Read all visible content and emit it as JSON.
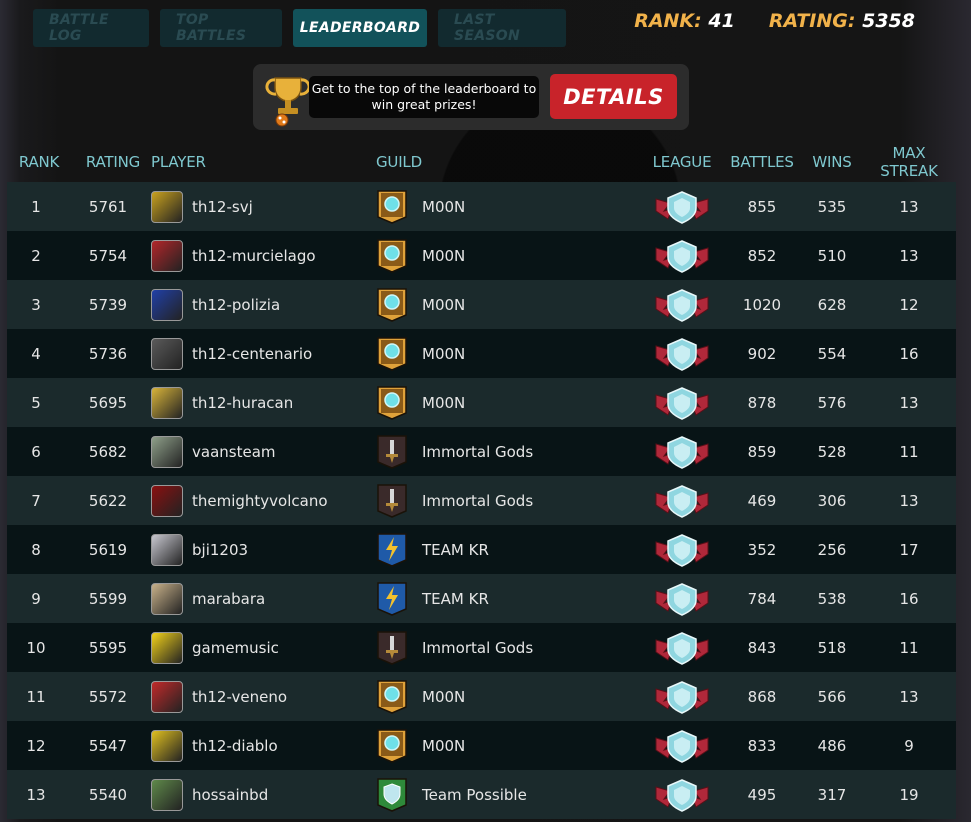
{
  "tabs": [
    {
      "label": "BATTLE LOG",
      "active": false
    },
    {
      "label": "TOP BATTLES",
      "active": false
    },
    {
      "label": "LEADERBOARD",
      "active": true
    },
    {
      "label": "LAST SEASON",
      "active": false
    }
  ],
  "user_stats": {
    "rank_label": "RANK:",
    "rank_value": "41",
    "rating_label": "RATING:",
    "rating_value": "5358"
  },
  "promo": {
    "message": "Get to the top of the leaderboard to win great prizes!",
    "details_label": "DETAILS"
  },
  "columns": {
    "rank": "RANK",
    "rating": "RATING",
    "player": "PLAYER",
    "guild": "GUILD",
    "league": "LEAGUE",
    "battles": "BATTLES",
    "wins": "WINS",
    "max_streak": "MAX STREAK"
  },
  "guild_icons": {
    "M00N": {
      "color": "#e0a23a",
      "icon": "moon-orb-icon"
    },
    "Immortal Gods": {
      "color": "#3a2a2a",
      "icon": "sword-icon"
    },
    "TEAM KR": {
      "color": "#1f5aa8",
      "icon": "lightning-icon"
    },
    "Team Possible": {
      "color": "#2e8a3a",
      "icon": "shield-icon"
    }
  },
  "rows": [
    {
      "rank": "1",
      "rating": "5761",
      "player": "th12-svj",
      "avatar_color": "#c9a21f",
      "guild": "M00N",
      "battles": "855",
      "wins": "535",
      "max_streak": "13"
    },
    {
      "rank": "2",
      "rating": "5754",
      "player": "th12-murcielago",
      "avatar_color": "#b3262a",
      "guild": "M00N",
      "battles": "852",
      "wins": "510",
      "max_streak": "13"
    },
    {
      "rank": "3",
      "rating": "5739",
      "player": "th12-polizia",
      "avatar_color": "#2140a8",
      "guild": "M00N",
      "battles": "1020",
      "wins": "628",
      "max_streak": "12"
    },
    {
      "rank": "4",
      "rating": "5736",
      "player": "th12-centenario",
      "avatar_color": "#5a5a5a",
      "guild": "M00N",
      "battles": "902",
      "wins": "554",
      "max_streak": "16"
    },
    {
      "rank": "5",
      "rating": "5695",
      "player": "th12-huracan",
      "avatar_color": "#d8b43a",
      "guild": "M00N",
      "battles": "878",
      "wins": "576",
      "max_streak": "13"
    },
    {
      "rank": "6",
      "rating": "5682",
      "player": "vaansteam",
      "avatar_color": "#8fa08a",
      "guild": "Immortal Gods",
      "battles": "859",
      "wins": "528",
      "max_streak": "11"
    },
    {
      "rank": "7",
      "rating": "5622",
      "player": "themightyvolcano",
      "avatar_color": "#8a1010",
      "guild": "Immortal Gods",
      "battles": "469",
      "wins": "306",
      "max_streak": "13"
    },
    {
      "rank": "8",
      "rating": "5619",
      "player": "bji1203",
      "avatar_color": "#c8c8d0",
      "guild": "TEAM KR",
      "battles": "352",
      "wins": "256",
      "max_streak": "17"
    },
    {
      "rank": "9",
      "rating": "5599",
      "player": "marabara",
      "avatar_color": "#c9b28a",
      "guild": "TEAM KR",
      "battles": "784",
      "wins": "538",
      "max_streak": "16"
    },
    {
      "rank": "10",
      "rating": "5595",
      "player": "gamemusic",
      "avatar_color": "#f2d21a",
      "guild": "Immortal Gods",
      "battles": "843",
      "wins": "518",
      "max_streak": "11"
    },
    {
      "rank": "11",
      "rating": "5572",
      "player": "th12-veneno",
      "avatar_color": "#c22a2a",
      "guild": "M00N",
      "battles": "868",
      "wins": "566",
      "max_streak": "13"
    },
    {
      "rank": "12",
      "rating": "5547",
      "player": "th12-diablo",
      "avatar_color": "#e0c020",
      "guild": "M00N",
      "battles": "833",
      "wins": "486",
      "max_streak": "9"
    },
    {
      "rank": "13",
      "rating": "5540",
      "player": "hossainbd",
      "avatar_color": "#5f8a4a",
      "guild": "Team Possible",
      "battles": "495",
      "wins": "317",
      "max_streak": "19"
    }
  ]
}
